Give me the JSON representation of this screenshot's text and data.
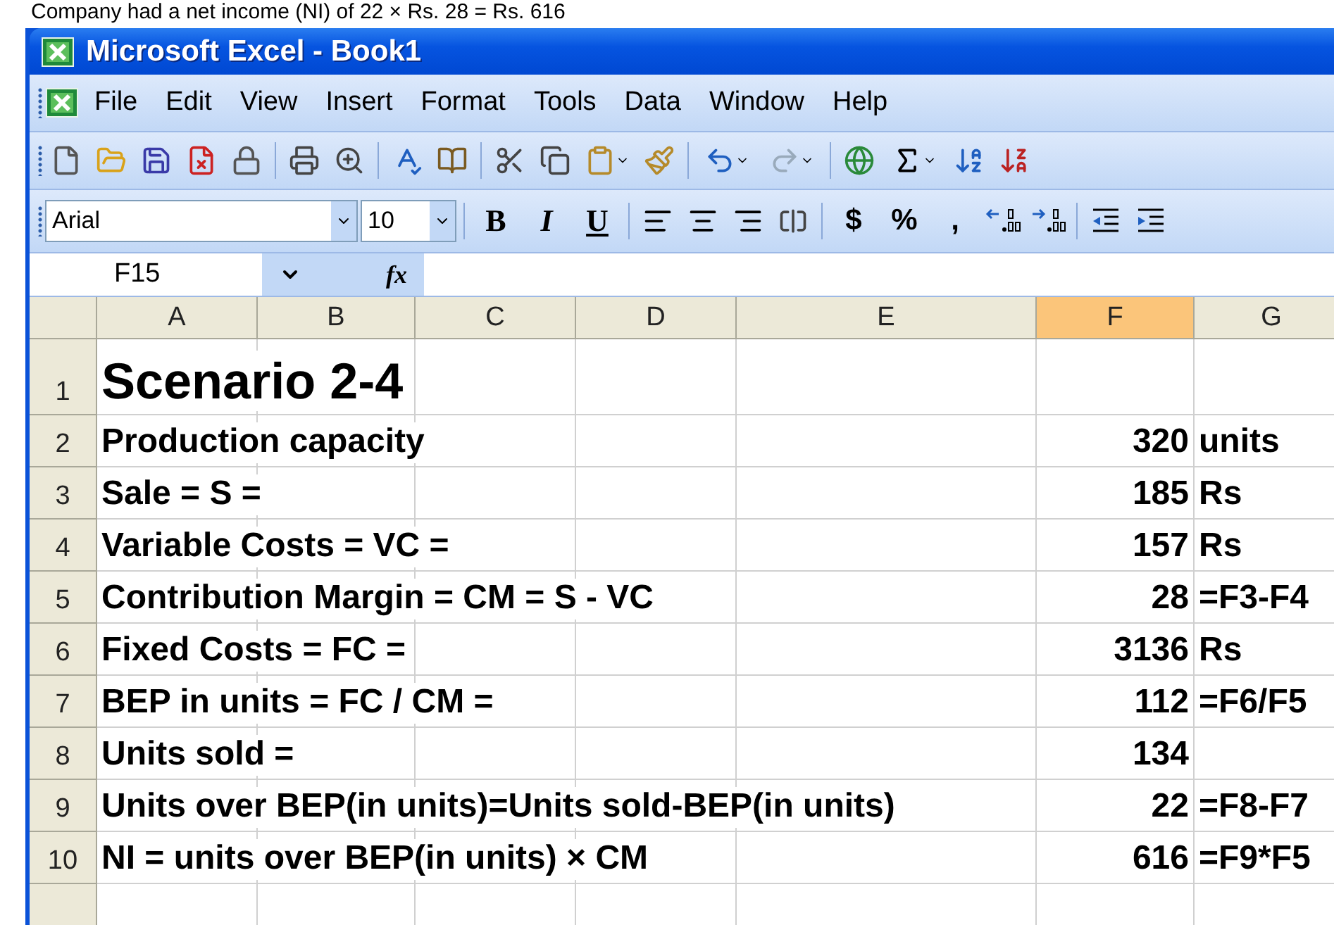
{
  "caption": "Company had a net income (NI) of 22 × Rs. 28 = Rs. 616",
  "window": {
    "title": "Microsoft Excel - Book1"
  },
  "menu": [
    "File",
    "Edit",
    "View",
    "Insert",
    "Format",
    "Tools",
    "Data",
    "Window",
    "Help"
  ],
  "formatting": {
    "font": "Arial",
    "size": "10",
    "buttons": [
      {
        "kind": "bold",
        "label": "B"
      },
      {
        "kind": "italic",
        "label": "I"
      },
      {
        "kind": "underline",
        "label": "U"
      }
    ],
    "number_buttons": [
      "$",
      "%",
      ","
    ]
  },
  "formula_bar": {
    "name_box": "F15",
    "fx": "fx"
  },
  "columns": [
    {
      "label": "A",
      "selected": false
    },
    {
      "label": "B",
      "selected": false
    },
    {
      "label": "C",
      "selected": false
    },
    {
      "label": "D",
      "selected": false
    },
    {
      "label": "E",
      "selected": false
    },
    {
      "label": "F",
      "selected": true
    },
    {
      "label": "G",
      "selected": false
    }
  ],
  "rows": [
    {
      "number": "1",
      "kind": "title",
      "label": "Scenario 2-4"
    },
    {
      "number": "2",
      "kind": "data",
      "label": "Production capacity",
      "value": "320",
      "unit": "units"
    },
    {
      "number": "3",
      "kind": "data",
      "label": "Sale = S =",
      "value": "185",
      "unit": "Rs"
    },
    {
      "number": "4",
      "kind": "data",
      "label": "Variable Costs = VC =",
      "value": "157",
      "unit": "Rs"
    },
    {
      "number": "5",
      "kind": "data",
      "label": "Contribution Margin = CM = S - VC",
      "value": "28",
      "unit": "=F3-F4"
    },
    {
      "number": "6",
      "kind": "data",
      "label": "Fixed Costs = FC =",
      "value": "3136",
      "unit": "Rs"
    },
    {
      "number": "7",
      "kind": "data",
      "label": "BEP in units = FC / CM =",
      "value": "112",
      "unit": "=F6/F5"
    },
    {
      "number": "8",
      "kind": "data",
      "label": "Units sold =",
      "value": "134"
    },
    {
      "number": "9",
      "kind": "data",
      "label": "Units over BEP(in units)=Units sold-BEP(in units)",
      "value": "22",
      "unit": "=F8-F7"
    },
    {
      "number": "10",
      "kind": "data",
      "label": "NI = units over BEP(in units) × CM",
      "value": "616",
      "unit": "=F9*F5"
    }
  ]
}
